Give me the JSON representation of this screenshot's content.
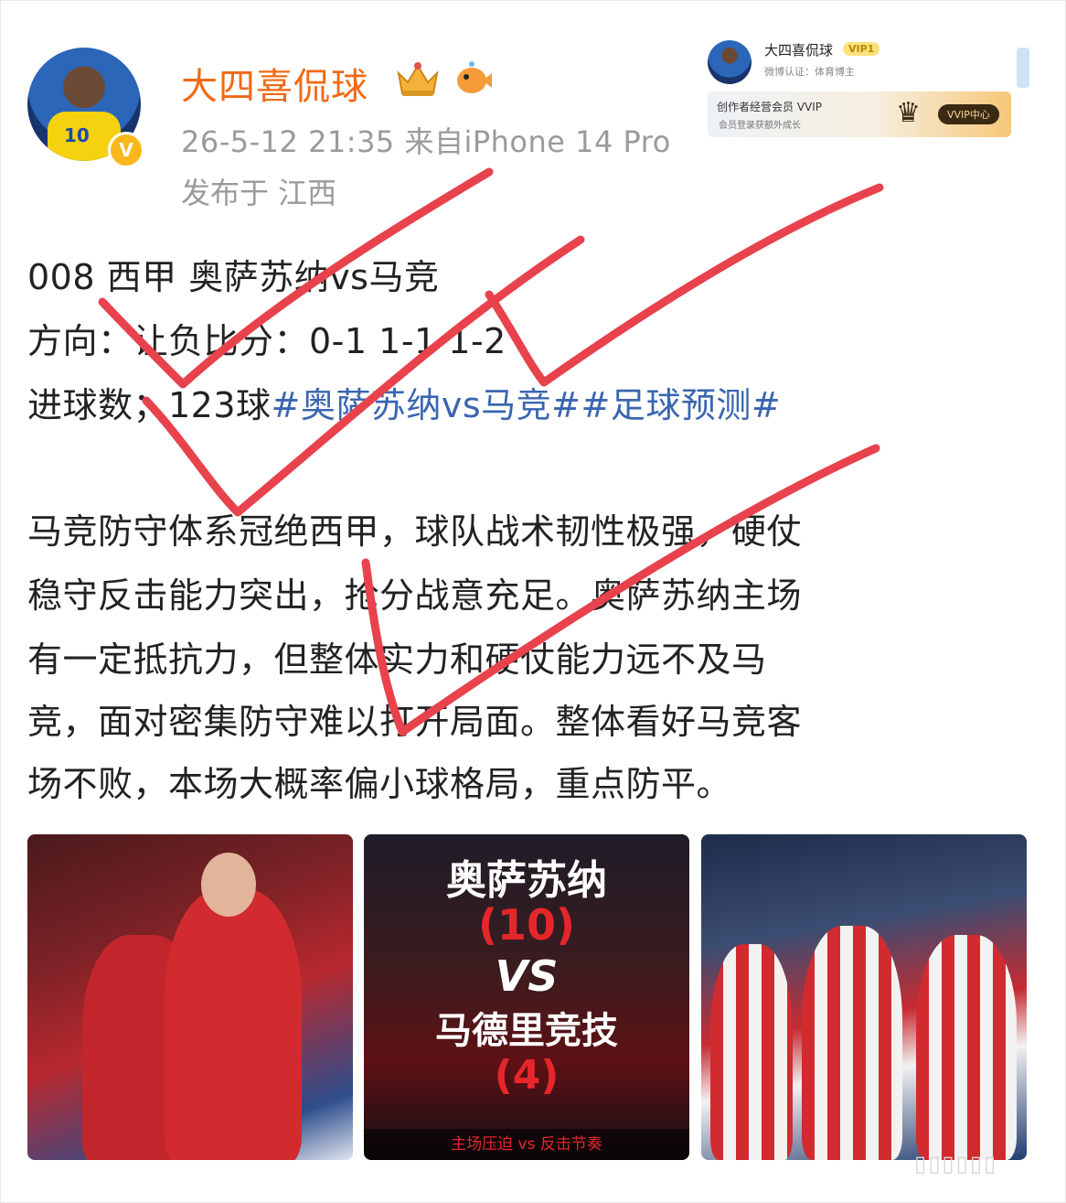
{
  "post": {
    "username": "大四喜侃球",
    "meta": "26-5-12 21:35 来自iPhone 14 Pro",
    "location": "发布于 江西",
    "lines": [
      "008 西甲 奥萨苏纳vs马竞",
      "方向：让负比分：0-1 1-1 1-2"
    ],
    "goals_prefix": "进球数；123球",
    "hashtags": "#奥萨苏纳vs马竞##足球预测#",
    "body_lines": [
      "马竞防守体系冠绝西甲，球队战术韧性极强，硬仗",
      "稳守反击能力突出，抢分战意充足。奥萨苏纳主场",
      "有一定抵抗力，但整体实力和硬仗能力远不及马",
      "竞，面对密集防守难以打开局面。整体看好马竞客",
      "场不败，本场大概率偏小球格局，重点防平。"
    ]
  },
  "mini_card": {
    "name": "大四喜侃球",
    "vip_label": "VIP1",
    "cert": "微博认证：体育博主",
    "vvip_title": "创作者经营会员 VVIP",
    "vvip_sub": "会员登录获额外成长",
    "vvip_button": "VVIP中心"
  },
  "images": {
    "img2_team1": "奥萨苏纳",
    "img2_rank1": "(10)",
    "img2_vs": "VS",
    "img2_team2": "马德里竞技",
    "img2_rank2": "(4)",
    "img2_bottom": "主场压迫 vs 反击节奏"
  },
  "icons": {
    "verified_badge": "V",
    "crown": "crown-icon",
    "fish": "fish-icon"
  },
  "colors": {
    "username": "#f06a15",
    "hashtag": "#3a66b0",
    "ink": "#e8424d"
  }
}
